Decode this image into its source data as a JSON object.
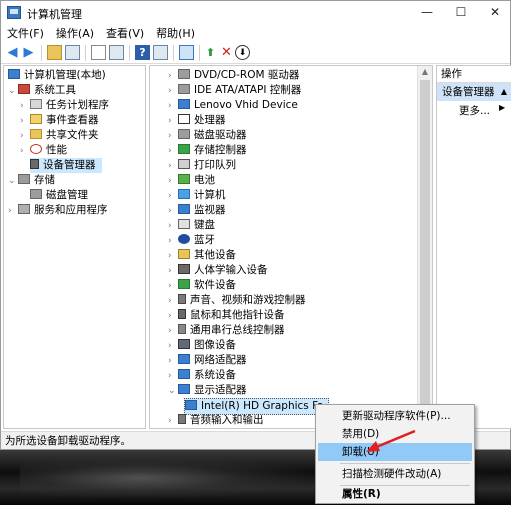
{
  "window": {
    "title": "计算机管理",
    "controls": {
      "minimize": "—",
      "maximize": "☐",
      "close": "✕"
    }
  },
  "menu": [
    "文件(F)",
    "操作(A)",
    "查看(V)",
    "帮助(H)"
  ],
  "tree": {
    "root": "计算机管理(本地)",
    "system_tools": "系统工具",
    "task_scheduler": "任务计划程序",
    "event_viewer": "事件查看器",
    "shared_folders": "共享文件夹",
    "performance": "性能",
    "device_manager": "设备管理器",
    "storage": "存储",
    "disk_management": "磁盘管理",
    "services_apps": "服务和应用程序"
  },
  "devices": [
    "DVD/CD-ROM 驱动器",
    "IDE ATA/ATAPI 控制器",
    "Lenovo Vhid Device",
    "处理器",
    "磁盘驱动器",
    "存储控制器",
    "打印队列",
    "电池",
    "计算机",
    "监视器",
    "键盘",
    "蓝牙",
    "其他设备",
    "人体学输入设备",
    "软件设备",
    "声音、视频和游戏控制器",
    "鼠标和其他指针设备",
    "通用串行总线控制器",
    "图像设备",
    "网络适配器",
    "系统设备",
    "显示适配器",
    "Intel(R) HD Graphics Fa",
    "音频输入和输出"
  ],
  "actions": {
    "header": "操作",
    "selected": "设备管理器",
    "more": "更多..."
  },
  "context_menu": {
    "update": "更新驱动程序软件(P)...",
    "disable": "禁用(D)",
    "uninstall": "卸载(U)",
    "scan": "扫描检测硬件改动(A)",
    "properties": "属性(R)"
  },
  "status": "为所选设备卸载驱动程序。",
  "colors": {
    "selection": "#cce8ff",
    "menu_highlight": "#91c9f7",
    "annotation_arrow": "#e02020"
  }
}
